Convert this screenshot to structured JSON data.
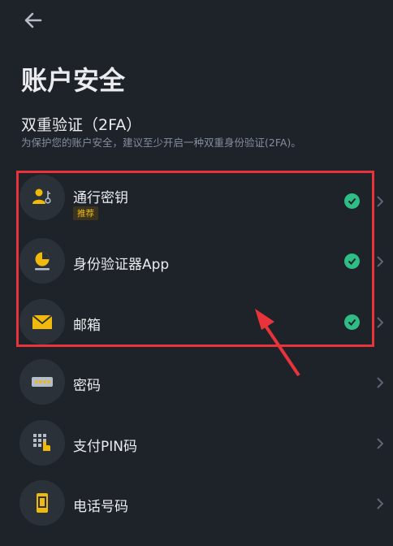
{
  "header": {
    "back_icon": "arrow-left-icon"
  },
  "page": {
    "title": "账户安全"
  },
  "section_2fa": {
    "title": "双重验证（2FA）",
    "description": "为保护您的账户安全，建议至少开启一种双重身份验证(2FA)。"
  },
  "items": [
    {
      "label": "通行密钥",
      "tag": "推荐",
      "icon": "passkey-icon",
      "enabled": true
    },
    {
      "label": "身份验证器App",
      "icon": "authenticator-icon",
      "enabled": true
    },
    {
      "label": "邮箱",
      "icon": "email-icon",
      "enabled": true
    },
    {
      "label": "密码",
      "icon": "password-icon",
      "enabled": false
    },
    {
      "label": "支付PIN码",
      "icon": "pin-icon",
      "enabled": false
    },
    {
      "label": "电话号码",
      "icon": "phone-icon",
      "enabled": false
    }
  ],
  "colors": {
    "background": "#1e2329",
    "icon_bg": "#2b3139",
    "accent_yellow": "#f0b90b",
    "check_green": "#2ebd85",
    "highlight_red": "#e8333a"
  }
}
